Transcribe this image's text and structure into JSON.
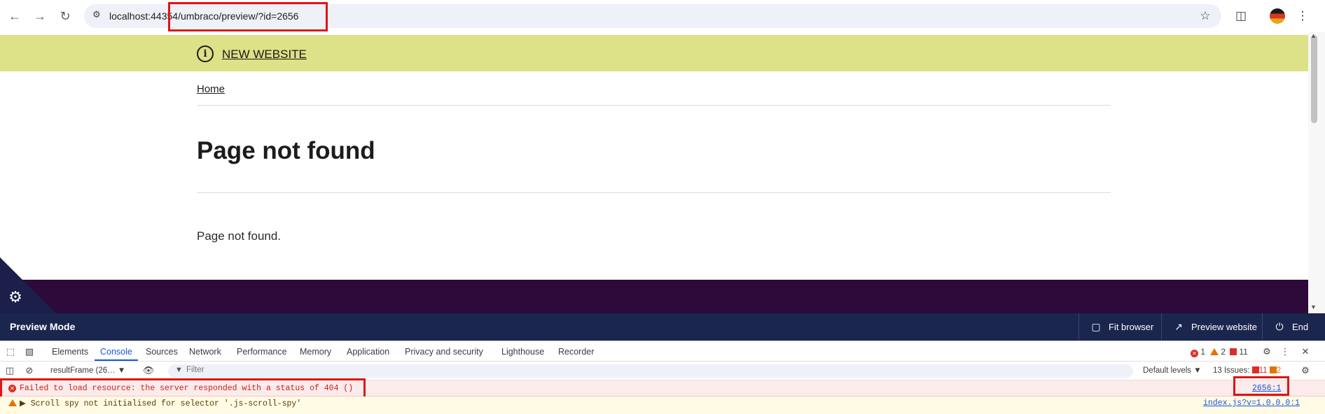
{
  "browser": {
    "url": "localhost:44354/umbraco/preview/?id=2656",
    "icons": [
      "back-icon",
      "forward-icon",
      "reload-icon",
      "site-info-icon",
      "bookmark-star-icon",
      "extensions-icon",
      "profile-avatar",
      "menu-icon"
    ]
  },
  "site": {
    "banner_link": "NEW WEBSITE",
    "breadcrumb": "Home",
    "title": "Page not found",
    "body": "Page not found."
  },
  "preview_bar": {
    "title": "Preview Mode",
    "fit_browser": "Fit browser",
    "preview_website": "Preview website",
    "end": "End"
  },
  "devtools": {
    "tabs": [
      "Elements",
      "Console",
      "Sources",
      "Network",
      "Performance",
      "Memory",
      "Application",
      "Privacy and security",
      "Lighthouse",
      "Recorder"
    ],
    "active_tab": "Console",
    "counts": {
      "errors": "1",
      "warnings": "2",
      "issues": "11"
    },
    "context": "resultFrame (26…",
    "filter_placeholder": "Filter",
    "levels": "Default levels",
    "issues_label": "13 Issues:",
    "issues_red": "11",
    "issues_orange": "2",
    "messages": [
      {
        "type": "error",
        "text": "Failed to load resource: the server responded with a status of 404 ()",
        "source": "2656:1"
      },
      {
        "type": "warning",
        "text": "▶ Scroll spy not initialised for selector '.js-scroll-spy'",
        "source": "index.js?v=1.0.0.0:1"
      }
    ]
  },
  "colors": {
    "banner": "#dde187",
    "footer": "#2c0a3a",
    "preview_bar": "#1b264f",
    "highlight": "#e01414"
  }
}
